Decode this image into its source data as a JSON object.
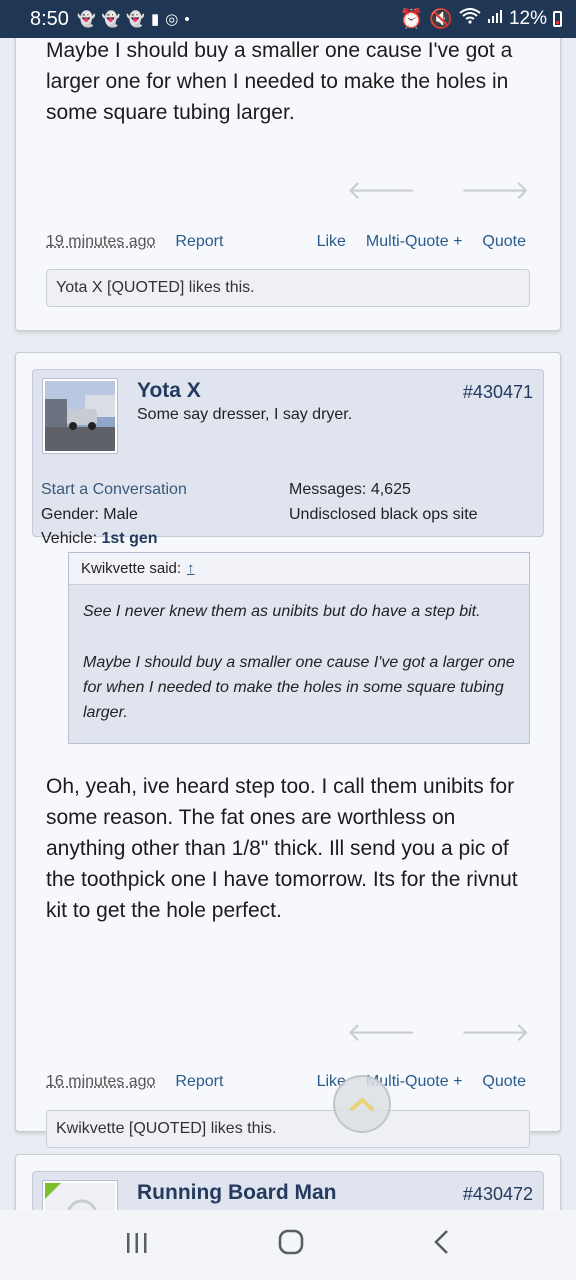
{
  "status": {
    "time": "8:50",
    "battery": "12%",
    "notification_icons": [
      "snapchat-icon",
      "snapchat-icon",
      "snapchat-icon",
      "alert-icon",
      "instagram-icon",
      "dot-icon"
    ],
    "right_icons": [
      "alarm-icon",
      "mute-icon",
      "wifi-icon",
      "signal-icon"
    ]
  },
  "post1": {
    "text_tail": "Maybe I should buy a smaller one cause I've got a larger one for when I needed to make the holes in some square tubing larger.",
    "timestamp": "19 minutes ago",
    "report": "Report",
    "like": "Like",
    "multiquote": "Multi-Quote +",
    "quote": "Quote",
    "likes_text": "Yota X [QUOTED] likes this."
  },
  "post2": {
    "username": "Yota X",
    "user_title": "Some say dresser, I say dryer.",
    "post_number": "#430471",
    "start_conversation": "Start a Conversation",
    "gender_label": "Gender:",
    "gender_value": "Male",
    "vehicle_label": "Vehicle:",
    "vehicle_value": "1st gen",
    "messages_label": "Messages:",
    "messages_value": "4,625",
    "location": "Undisclosed black ops site",
    "quote_author": "Kwikvette said:",
    "quote_link": "↑",
    "quote_p1": "See I never knew them as unibits but do have a step bit.",
    "quote_p2": "Maybe I should buy a smaller one cause I've got a larger one for when I needed to make the holes in some square tubing larger.",
    "body": "Oh, yeah, ive heard step too. I call them unibits for some reason. The fat ones are worthless on anything other than 1/8\" thick. Ill send you a pic of the toothpick one I have tomorrow. Its for the rivnut kit to get the hole perfect.",
    "timestamp": "16 minutes ago",
    "report": "Report",
    "like": "Like",
    "multiquote": "Multi-Quote +",
    "quote": "Quote",
    "likes_text": "Kwikvette [QUOTED] likes this."
  },
  "post3": {
    "username": "Running Board Man",
    "post_number": "#430472"
  },
  "colors": {
    "status_bar": "#1f3654",
    "link": "#2a5b8c",
    "username": "#243a5e",
    "userbox": "#dfe4ef"
  }
}
